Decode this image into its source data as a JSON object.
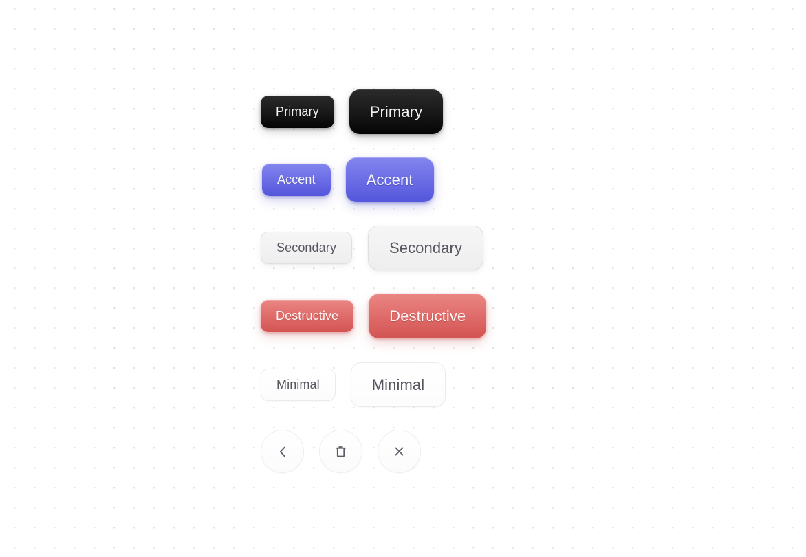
{
  "canvas": {
    "background_color": "#ffffff",
    "dot_color": "#e4e4e6",
    "dot_spacing_px": 29
  },
  "button_rows": [
    {
      "variant": "primary",
      "accent_color": "#111111",
      "small": {
        "label": "Primary",
        "size": "small"
      },
      "large": {
        "label": "Primary",
        "size": "large"
      }
    },
    {
      "variant": "accent",
      "accent_color": "#6d6fe6",
      "small": {
        "label": "Accent",
        "size": "small"
      },
      "large": {
        "label": "Accent",
        "size": "large"
      }
    },
    {
      "variant": "secondary",
      "accent_color": "#eeeeef",
      "small": {
        "label": "Secondary",
        "size": "small"
      },
      "large": {
        "label": "Secondary",
        "size": "large"
      }
    },
    {
      "variant": "destructive",
      "accent_color": "#e06e6c",
      "small": {
        "label": "Destructive",
        "size": "small"
      },
      "large": {
        "label": "Destructive",
        "size": "large"
      }
    },
    {
      "variant": "minimal",
      "accent_color": "#ffffff",
      "small": {
        "label": "Minimal",
        "size": "small"
      },
      "large": {
        "label": "Minimal",
        "size": "large"
      }
    }
  ],
  "icon_buttons": [
    {
      "icon": "chevron-left-icon"
    },
    {
      "icon": "trash-icon"
    },
    {
      "icon": "close-icon"
    }
  ]
}
